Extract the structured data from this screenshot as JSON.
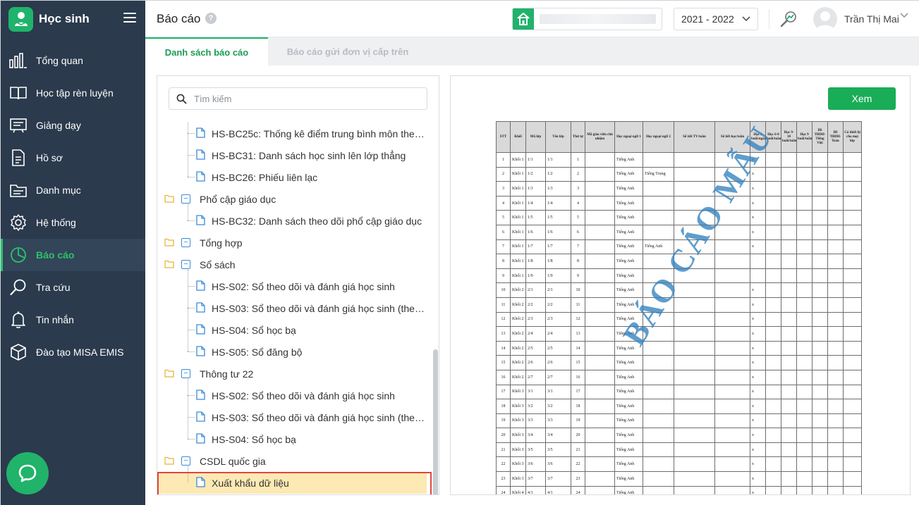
{
  "app": {
    "name": "Học sinh"
  },
  "sidebar": {
    "items": [
      {
        "label": "Tổng quan",
        "icon": "bar-chart-icon"
      },
      {
        "label": "Học tập rèn luyện",
        "icon": "book-open-icon"
      },
      {
        "label": "Giảng dạy",
        "icon": "board-icon"
      },
      {
        "label": "Hồ sơ",
        "icon": "document-icon"
      },
      {
        "label": "Danh mục",
        "icon": "folder-icon"
      },
      {
        "label": "Hệ thống",
        "icon": "gear-icon"
      },
      {
        "label": "Báo cáo",
        "icon": "pie-chart-icon",
        "active": true
      },
      {
        "label": "Tra cứu",
        "icon": "search-icon"
      },
      {
        "label": "Tin nhắn",
        "icon": "bell-icon"
      },
      {
        "label": "Đào tạo MISA EMIS",
        "icon": "box-icon"
      }
    ]
  },
  "header": {
    "title": "Báo cáo",
    "help": "?",
    "school_year": "2021 - 2022",
    "user_name": "Trần Thị Mai"
  },
  "tabs": [
    {
      "label": "Danh sách báo cáo",
      "active": true
    },
    {
      "label": "Báo cáo gửi đơn vị cấp trên",
      "active": false
    }
  ],
  "tree": {
    "search_placeholder": "Tìm kiếm",
    "rows": [
      {
        "type": "file",
        "label": "HS-BC25c: Thống kê điểm trung bình môn theo khối"
      },
      {
        "type": "file",
        "label": "HS-BC31: Danh sách học sinh lên lớp thẳng"
      },
      {
        "type": "file",
        "label": "HS-BC26: Phiếu liên lạc"
      },
      {
        "type": "folder",
        "label": "Phổ cập giáo dục"
      },
      {
        "type": "file",
        "label": "HS-BC32: Danh sách theo dõi phổ cập giáo dục"
      },
      {
        "type": "folder",
        "label": "Tổng hợp"
      },
      {
        "type": "folder",
        "label": "Sổ sách"
      },
      {
        "type": "file",
        "label": "HS-S02: Sổ theo dõi và đánh giá học sinh"
      },
      {
        "type": "file",
        "label": "HS-S03: Sổ theo dõi và đánh giá học sinh (theo lớp)"
      },
      {
        "type": "file",
        "label": "HS-S04: Sổ học bạ"
      },
      {
        "type": "file",
        "label": "HS-S05: Sổ đăng bộ"
      },
      {
        "type": "folder",
        "label": "Thông tư 22"
      },
      {
        "type": "file",
        "label": "HS-S02: Sổ theo dõi và đánh giá học sinh"
      },
      {
        "type": "file",
        "label": "HS-S03: Sổ theo dõi và đánh giá học sinh (theo lớp)"
      },
      {
        "type": "file",
        "label": "HS-S04: Sổ học bạ"
      },
      {
        "type": "folder",
        "label": "CSDL quốc gia"
      },
      {
        "type": "file",
        "label": "Xuất khẩu dữ liệu",
        "selected": true
      }
    ]
  },
  "preview": {
    "view_button": "Xem",
    "watermark": "BÁO CÁO MẪU",
    "columns": [
      "STT",
      "Khối",
      "Mã lớp",
      "Tên lớp",
      "Thứ tự",
      "Mã giáo viên chủ nhiệm",
      "Học ngoại ngữ 1",
      "Học ngoại ngữ 2",
      "Số tiết TV/tuần",
      "Số tiết học/tuần",
      "Học 2 buổi/ngày",
      "Học 6-8 buổi/tuần",
      "Học 9-10 buổi/tuần",
      "Học 9 buổi/tuần",
      "Đề TBDH-Tiếng Việt",
      "Đề TBDH-Toán",
      "Có thiết bị cho mọi lớp"
    ],
    "rows": [
      [
        "1",
        "Khối 1",
        "1/1",
        "1/1",
        "1",
        "",
        "Tiếng Anh",
        "",
        "",
        "",
        "x",
        "",
        "",
        "",
        "",
        "",
        ""
      ],
      [
        "2",
        "Khối 1",
        "1/2",
        "1/2",
        "2",
        "",
        "Tiếng Anh",
        "Tiếng Trung",
        "",
        "",
        "x",
        "",
        "",
        "",
        "",
        "",
        ""
      ],
      [
        "3",
        "Khối 1",
        "1/3",
        "1/3",
        "3",
        "",
        "Tiếng Anh",
        "",
        "",
        "",
        "x",
        "",
        "",
        "",
        "",
        "",
        ""
      ],
      [
        "4",
        "Khối 1",
        "1/4",
        "1/4",
        "4",
        "",
        "Tiếng Anh",
        "",
        "",
        "",
        "x",
        "",
        "",
        "",
        "",
        "",
        ""
      ],
      [
        "5",
        "Khối 1",
        "1/5",
        "1/5",
        "5",
        "",
        "Tiếng Anh",
        "",
        "",
        "",
        "x",
        "",
        "",
        "",
        "",
        "",
        ""
      ],
      [
        "6",
        "Khối 1",
        "1/6",
        "1/6",
        "6",
        "",
        "Tiếng Anh",
        "",
        "",
        "",
        "x",
        "",
        "",
        "",
        "",
        "",
        ""
      ],
      [
        "7",
        "Khối 1",
        "1/7",
        "1/7",
        "7",
        "",
        "Tiếng Anh",
        "Tiếng Anh",
        "",
        "",
        "x",
        "",
        "",
        "",
        "",
        "",
        ""
      ],
      [
        "8",
        "Khối 1",
        "1/8",
        "1/8",
        "8",
        "",
        "Tiếng Anh",
        "",
        "",
        "",
        "",
        "",
        "",
        "",
        "",
        "",
        ""
      ],
      [
        "9",
        "Khối 1",
        "1/9",
        "1/9",
        "9",
        "",
        "Tiếng Anh",
        "",
        "",
        "",
        "",
        "",
        "",
        "",
        "",
        "",
        ""
      ],
      [
        "10",
        "Khối 2",
        "2/1",
        "2/1",
        "10",
        "",
        "Tiếng Anh",
        "",
        "",
        "",
        "x",
        "",
        "",
        "",
        "",
        "",
        ""
      ],
      [
        "11",
        "Khối 2",
        "2/2",
        "2/2",
        "11",
        "",
        "Tiếng Anh",
        "",
        "",
        "",
        "x",
        "",
        "",
        "",
        "",
        "",
        ""
      ],
      [
        "12",
        "Khối 2",
        "2/3",
        "2/3",
        "12",
        "",
        "Tiếng Anh",
        "",
        "",
        "",
        "x",
        "",
        "",
        "",
        "",
        "",
        ""
      ],
      [
        "13",
        "Khối 2",
        "2/4",
        "2/4",
        "13",
        "",
        "Tiếng Anh",
        "",
        "",
        "",
        "x",
        "",
        "",
        "",
        "",
        "",
        ""
      ],
      [
        "14",
        "Khối 2",
        "2/5",
        "2/5",
        "14",
        "",
        "Tiếng Anh",
        "",
        "",
        "",
        "x",
        "",
        "",
        "",
        "",
        "",
        ""
      ],
      [
        "15",
        "Khối 2",
        "2/6",
        "2/6",
        "15",
        "",
        "Tiếng Anh",
        "",
        "",
        "",
        "x",
        "",
        "",
        "",
        "",
        "",
        ""
      ],
      [
        "16",
        "Khối 2",
        "2/7",
        "2/7",
        "16",
        "",
        "Tiếng Anh",
        "",
        "",
        "",
        "x",
        "",
        "",
        "",
        "",
        "",
        ""
      ],
      [
        "17",
        "Khối 3",
        "3/1",
        "3/1",
        "17",
        "",
        "Tiếng Anh",
        "",
        "",
        "",
        "x",
        "",
        "",
        "",
        "",
        "",
        ""
      ],
      [
        "18",
        "Khối 3",
        "3/2",
        "3/2",
        "18",
        "",
        "Tiếng Anh",
        "",
        "",
        "",
        "x",
        "",
        "",
        "",
        "",
        "",
        ""
      ],
      [
        "19",
        "Khối 3",
        "3/3",
        "3/3",
        "19",
        "",
        "Tiếng Anh",
        "",
        "",
        "",
        "x",
        "",
        "",
        "",
        "",
        "",
        ""
      ],
      [
        "20",
        "Khối 3",
        "3/4",
        "3/4",
        "20",
        "",
        "Tiếng Anh",
        "",
        "",
        "",
        "x",
        "",
        "",
        "",
        "",
        "",
        ""
      ],
      [
        "21",
        "Khối 3",
        "3/5",
        "3/5",
        "21",
        "",
        "Tiếng Anh",
        "",
        "",
        "",
        "x",
        "",
        "",
        "",
        "",
        "",
        ""
      ],
      [
        "22",
        "Khối 3",
        "3/6",
        "3/6",
        "22",
        "",
        "Tiếng Anh",
        "",
        "",
        "",
        "x",
        "",
        "",
        "",
        "",
        "",
        ""
      ],
      [
        "23",
        "Khối 3",
        "3/7",
        "3/7",
        "23",
        "",
        "Tiếng Anh",
        "",
        "",
        "",
        "x",
        "",
        "",
        "",
        "",
        "",
        ""
      ],
      [
        "24",
        "Khối 4",
        "4/1",
        "4/1",
        "24",
        "",
        "Tiếng Anh",
        "",
        "",
        "",
        "x",
        "",
        "",
        "",
        "",
        "",
        ""
      ]
    ]
  },
  "colors": {
    "sidebar_bg": "#2b3a4d",
    "accent_green": "#1fb36b",
    "selected_row": "#fde9b3",
    "highlight_border": "#e4453c",
    "watermark": "#3282be"
  }
}
